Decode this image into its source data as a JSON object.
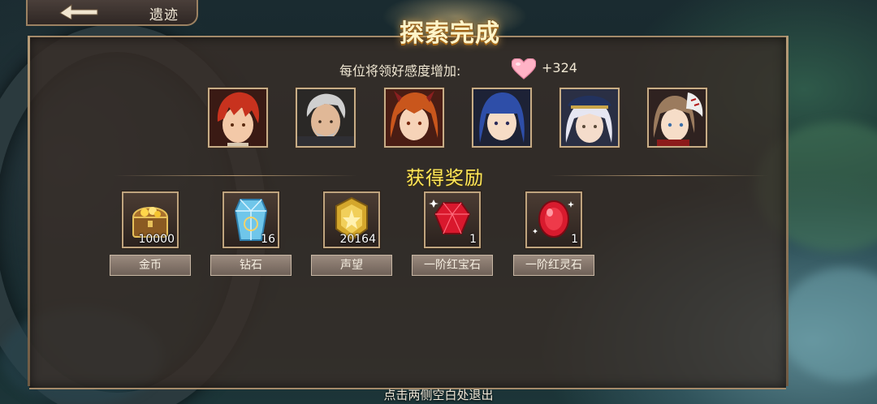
{
  "nav": {
    "title": "遗迹"
  },
  "header": {
    "title": "探索完成"
  },
  "affection": {
    "label": "每位将领好感度增加:",
    "value": "+324",
    "icon": "heart-icon"
  },
  "portraits": [
    {
      "name": "hero-portrait-1",
      "hair": "#c8321e"
    },
    {
      "name": "hero-portrait-2",
      "hair": "#bdbdbd"
    },
    {
      "name": "hero-portrait-3",
      "hair": "#c9561c"
    },
    {
      "name": "hero-portrait-4",
      "hair": "#2e4ea8"
    },
    {
      "name": "hero-portrait-5",
      "hair": "#e6e6f2"
    },
    {
      "name": "hero-portrait-6",
      "hair": "#9b7b5e"
    }
  ],
  "rewards": {
    "title": "获得奖励",
    "items": [
      {
        "label": "金币",
        "count": "10000",
        "icon": "treasure-chest-icon"
      },
      {
        "label": "钻石",
        "count": "16",
        "icon": "crystal-icon"
      },
      {
        "label": "声望",
        "count": "20164",
        "icon": "prestige-medal-icon"
      },
      {
        "label": "一阶红宝石",
        "count": "1",
        "icon": "red-ruby-icon"
      },
      {
        "label": "一阶红灵石",
        "count": "1",
        "icon": "red-spirit-stone-icon"
      }
    ]
  },
  "footer": {
    "hint": "点击两侧空白处退出"
  },
  "colors": {
    "accent_gold": "#ffe85a",
    "panel": "#3a2e28",
    "frame": "#bfa47e"
  }
}
